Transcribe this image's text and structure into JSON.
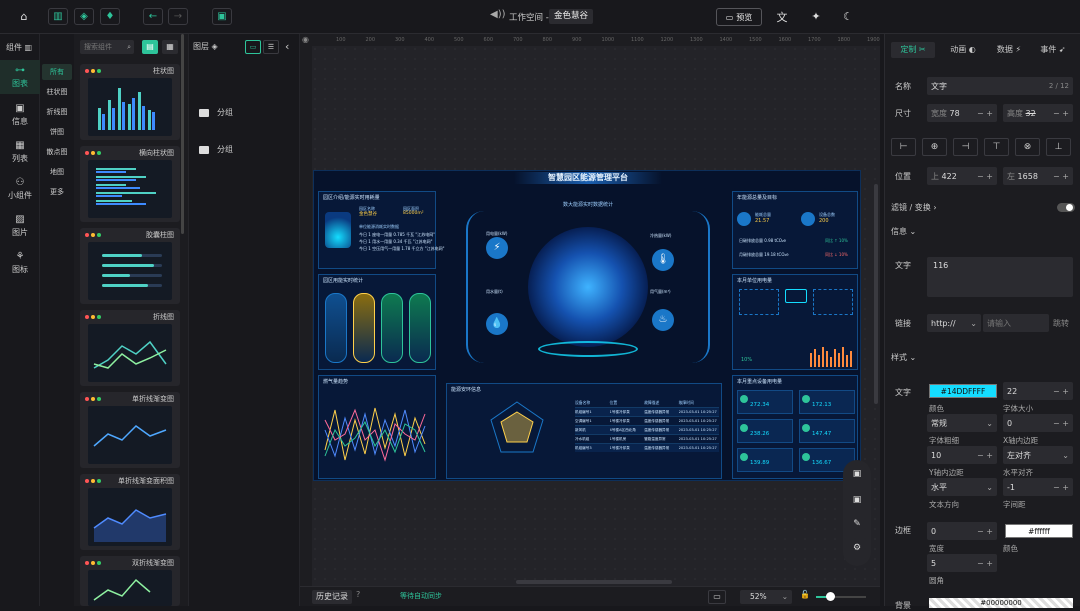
{
  "top": {
    "center_icon": "megaphone-icon",
    "workspace": "工作空间 -",
    "project": "金色慧谷",
    "preview": "预览",
    "icons": [
      "home-icon",
      "bar-chart-icon",
      "layers-icon",
      "water-drop-icon",
      "arrow-left-icon",
      "arrow-right-icon",
      "save-icon",
      "translate-icon",
      "magic-icon",
      "moon-icon"
    ]
  },
  "nav": [
    {
      "label": "图表",
      "icon": "chart-icon"
    },
    {
      "label": "信息",
      "icon": "info-icon"
    },
    {
      "label": "列表",
      "icon": "table-icon"
    },
    {
      "label": "小组件",
      "icon": "widget-icon"
    },
    {
      "label": "图片",
      "icon": "image-icon"
    },
    {
      "label": "图标",
      "icon": "icon-icon"
    }
  ],
  "components_title": "组件",
  "search_placeholder": "搜索组件",
  "categories": [
    "所有",
    "柱状图",
    "折线图",
    "饼图",
    "散点图",
    "地图",
    "更多"
  ],
  "cards": [
    "柱状图",
    "横向柱状图",
    "胶囊柱图",
    "折线图",
    "单折线渐变图",
    "单折线渐变面积图",
    "双折线渐变图"
  ],
  "layers": {
    "title": "图层",
    "items": [
      "分组",
      "分组"
    ]
  },
  "ruler": [
    "100",
    "200",
    "300",
    "400",
    "500",
    "600",
    "700",
    "800",
    "900",
    "1000",
    "1100",
    "1200",
    "1300",
    "1400",
    "1500",
    "1600",
    "1700",
    "1800",
    "1900"
  ],
  "dashboard": {
    "title": "智慧园区能源管理平台",
    "center_sub": "数大能源实时数据统计",
    "p1": "园区介绍/能源实时用耗量",
    "area_label": "园区名称",
    "area_value": "金色慧谷",
    "size_label": "园区面积",
    "size_value": "85000m²",
    "p1_sub": "单位能源消耗实时数据",
    "lines": [
      "今日 1 座电一用量 0.785 千瓦 \"江苏电网\"",
      "今日 1 用水一用量 0.34 千瓦 \"江苏电网\"",
      "今日 1 空压用气一用量 1.78 千立方 \"江苏电网\""
    ],
    "p2": "园区用能实时统计",
    "p3": "燃气量趋势",
    "p4": "能源安环信息",
    "p5": "年能源总量及目标",
    "stat1_label": "能耗总量",
    "stat1_value": "21.57",
    "stat2_label": "设备总数",
    "stat2_value": "200",
    "row1": "日碳排放总量 0.98 tCO₂e",
    "row1b": "同比 ↑ 10%",
    "row2": "月碳排放总量 19.18 tCO₂e",
    "row2b": "同比 ↓ 10%",
    "p6": "本月单位用电量",
    "p7": "本月重点设备用电量",
    "center_items": [
      "用电量(kW)",
      "冷热量(kW)",
      "用水量(t)",
      "用气量(m³)"
    ],
    "table_headers": [
      "设备名称",
      "位置",
      "故障描述",
      "故障时间"
    ],
    "table_rows": [
      [
        "机组编号1",
        "1号楼冷却泵",
        "温度传感器异常",
        "2023-03-01 10:25:27"
      ],
      [
        "空调编号1",
        "1号楼冷却泵",
        "温度传感器异常",
        "2023-03-01 10:25:27"
      ],
      [
        "新风机",
        "4号楼A区西北角",
        "温度传感器异常",
        "2023-03-01 10:25:27"
      ],
      [
        "冷水机组",
        "1号楼机房",
        "管路温度异常",
        "2023-03-01 10:25:27"
      ],
      [
        "机组编号3",
        "1号楼冷却泵",
        "温度传感器异常",
        "2023-03-01 10:25:27"
      ]
    ],
    "devices": [
      {
        "v": "272.34"
      },
      {
        "v": "172.13"
      },
      {
        "v": "238.26"
      },
      {
        "v": "147.47"
      },
      {
        "v": "139.89"
      },
      {
        "v": "136.67"
      }
    ],
    "growth": "10%"
  },
  "bottom": {
    "history": "历史记录",
    "sync": "等待自动同步",
    "zoom": "52%"
  },
  "props": {
    "tabs": [
      "定制",
      "动画",
      "数据",
      "事件"
    ],
    "name_label": "名称",
    "name_value": "文字",
    "name_count": "2 / 12",
    "size_label": "尺寸",
    "width_label": "宽度",
    "width_value": "78",
    "height_label": "高度",
    "height_value": "32",
    "pos_label": "位置",
    "top_label": "上",
    "top_value": "422",
    "left_label": "左",
    "left_value": "1658",
    "filter_label": "滤镜 / 变换",
    "info_label": "信息",
    "text_label": "文字",
    "text_value": "116",
    "link_label": "链接",
    "link_proto": "http://",
    "link_placeholder": "请输入",
    "link_jump": "跳转",
    "style_label": "样式",
    "text_style_label": "文字",
    "color_value": "#14DDFFFF",
    "font_size": "22",
    "color_caption": "颜色",
    "font_size_caption": "字体大小",
    "weight": "常规",
    "weight_caption": "字体粗细",
    "x_spacing": "0",
    "x_caption": "X轴内边距",
    "y_spacing": "10",
    "y_caption": "Y轴内边距",
    "align": "左对齐",
    "align_caption": "水平对齐",
    "direction": "水平",
    "direction_caption": "文本方向",
    "letter": "-1",
    "letter_caption": "字间距",
    "border_label": "边框",
    "border_width": "0",
    "border_color": "#ffffff",
    "width_caption": "宽度",
    "color_caption2": "颜色",
    "radius": "5",
    "radius_caption": "圆角",
    "bg_label": "背景",
    "bg_value": "#00000000"
  },
  "colors": {
    "accent": "#2ec49a",
    "cyan": "#14ddff",
    "series": [
      "#2ec49a",
      "#4f8bff",
      "#ffd04a",
      "#ff6b6b"
    ]
  }
}
